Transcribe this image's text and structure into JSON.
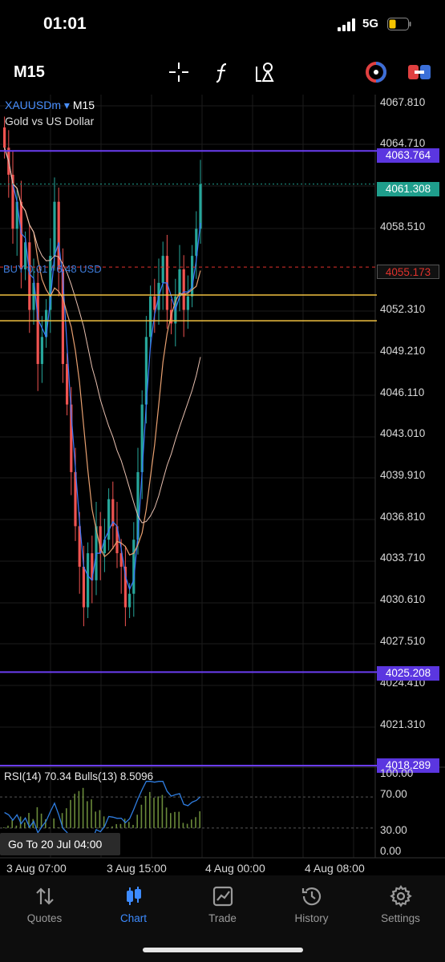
{
  "status": {
    "time": "01:01",
    "network": "5G"
  },
  "toolbar": {
    "timeframe": "M15"
  },
  "chart": {
    "symbol": "XAUUSDm",
    "symbol_caret": "▾",
    "timeframe": "M15",
    "description": "Gold vs US Dollar",
    "position_label": "BUY 0.01 / 6.48 USD",
    "price_labels": [
      "4067.810",
      "4064.710",
      "4058.510",
      "4052.310",
      "4049.210",
      "4046.110",
      "4043.010",
      "4039.910",
      "4036.810",
      "4033.710",
      "4030.610",
      "4027.510",
      "4024.410",
      "4021.310"
    ],
    "level_tags": {
      "upper_level": "4063.764",
      "current_price": "4061.308",
      "position_price": "4055.173",
      "lower_level": "4025.208",
      "bottom_level": "4018.289"
    },
    "rsi": {
      "label": "RSI(14) 70.34 Bulls(13) 8.5096",
      "levels": [
        "100.00",
        "70.00",
        "30.00",
        "0.00"
      ]
    },
    "goto_label": "Go To 20 Jul 04:00",
    "time_labels": [
      "3 Aug 07:00",
      "3 Aug 15:00",
      "4 Aug 00:00",
      "4 Aug 08:00"
    ],
    "colors": {
      "bull": "#26a69a",
      "bear": "#ef5350",
      "level": "#6a3df0",
      "yellow": "#f0c040",
      "current": "#1f9e8c",
      "position": "#e0322c"
    }
  },
  "chart_data": {
    "type": "candlestick",
    "symbol": "XAUUSDm",
    "timeframe": "M15",
    "ylim": [
      4018.289,
      4067.81
    ],
    "candles_close": [
      4064,
      4062,
      4058,
      4060,
      4055,
      4057,
      4052,
      4054,
      4048,
      4050,
      4052,
      4056,
      4060,
      4055,
      4048,
      4045,
      4040,
      4036,
      4033,
      4030,
      4034,
      4032,
      4036,
      4034,
      4035,
      4038,
      4036,
      4034,
      4033,
      4030,
      4031,
      4035,
      4040,
      4045,
      4050,
      4053,
      4052,
      4054,
      4056,
      4052,
      4051,
      4053,
      4055,
      4052,
      4053,
      4056,
      4058,
      4061.3
    ],
    "levels": [
      4063.764,
      4061.308,
      4055.173,
      4053.1,
      4051.2,
      4025.208,
      4018.289
    ],
    "rsi_value": 70.34,
    "bulls_value": 8.5096
  },
  "tabs": [
    {
      "label": "Quotes",
      "icon": "arrows-updown-icon"
    },
    {
      "label": "Chart",
      "icon": "candles-icon"
    },
    {
      "label": "Trade",
      "icon": "trend-chart-icon"
    },
    {
      "label": "History",
      "icon": "history-clock-icon"
    },
    {
      "label": "Settings",
      "icon": "gear-icon"
    }
  ]
}
